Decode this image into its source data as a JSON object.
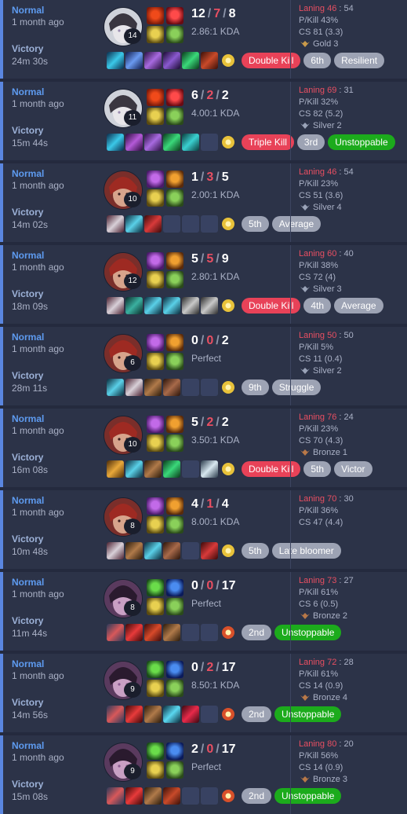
{
  "colors": {
    "accent": "#5e9bf0",
    "death": "#e84f62",
    "badge_red": "#e84258",
    "badge_grey": "#9da3b4",
    "badge_green": "#1cab1c"
  },
  "matches": [
    {
      "mode": "Normal",
      "ago": "1 month ago",
      "result": "Victory",
      "duration": "24m 30s",
      "champion": "pale-mage",
      "level": "14",
      "spells": [
        "ignite-icon",
        "flash-icon",
        "rune-precision-icon",
        "rune-resolve-icon"
      ],
      "kills": "12",
      "deaths": "7",
      "assists": "8",
      "ratio": "2.86:1 KDA",
      "items": [
        "cyan-ring-item",
        "blue-staff-item",
        "violet-orb-item",
        "violet-tome-item",
        "green-vial-item",
        "red-book-item"
      ],
      "badges": [
        {
          "label": "Double Kill",
          "style": "red"
        },
        {
          "label": "6th",
          "style": "grey"
        },
        {
          "label": "Resilient",
          "style": "grey"
        }
      ],
      "laning_label": "Laning 46",
      "laning_vs": "54",
      "pkill": "P/Kill 43%",
      "cs": "CS 81 (3.3)",
      "rank": "Gold 3",
      "rank_color": "#c99a4a"
    },
    {
      "mode": "Normal",
      "ago": "1 month ago",
      "result": "Victory",
      "duration": "15m 44s",
      "champion": "pale-mage",
      "level": "11",
      "spells": [
        "ignite-icon",
        "flash-icon",
        "rune-precision-icon",
        "rune-resolve-icon"
      ],
      "kills": "6",
      "deaths": "2",
      "assists": "2",
      "ratio": "4.00:1 KDA",
      "items": [
        "cyan-ring-item",
        "violet-staff-item",
        "violet-orb-item",
        "green-vial-item",
        "teal-gem-item",
        "empty"
      ],
      "badges": [
        {
          "label": "Triple Kill",
          "style": "red"
        },
        {
          "label": "3rd",
          "style": "grey"
        },
        {
          "label": "Unstoppable",
          "style": "green"
        }
      ],
      "laning_label": "Laning 69",
      "laning_vs": "31",
      "pkill": "P/Kill 32%",
      "cs": "CS 82 (5.2)",
      "rank": "Silver 2",
      "rank_color": "#9aa3b8"
    },
    {
      "mode": "Normal",
      "ago": "1 month ago",
      "result": "Victory",
      "duration": "14m 02s",
      "champion": "red-swordsman",
      "level": "10",
      "spells": [
        "flash-violet-icon",
        "ghost-icon",
        "rune-precision-icon",
        "rune-resolve-icon"
      ],
      "kills": "1",
      "deaths": "3",
      "assists": "5",
      "ratio": "2.00:1 KDA",
      "items": [
        "dagger-item",
        "cyan-blade-item",
        "red-potion-item",
        "empty",
        "empty",
        "empty"
      ],
      "badges": [
        {
          "label": "5th",
          "style": "grey"
        },
        {
          "label": "Average",
          "style": "grey"
        }
      ],
      "laning_label": "Laning 46",
      "laning_vs": "54",
      "pkill": "P/Kill 23%",
      "cs": "CS 51 (3.6)",
      "rank": "Silver 4",
      "rank_color": "#9aa3b8"
    },
    {
      "mode": "Normal",
      "ago": "1 month ago",
      "result": "Victory",
      "duration": "18m 09s",
      "champion": "red-swordsman",
      "level": "12",
      "spells": [
        "flash-violet-icon",
        "ghost-icon",
        "rune-precision-icon",
        "rune-resolve-icon"
      ],
      "kills": "5",
      "deaths": "5",
      "assists": "9",
      "ratio": "2.80:1 KDA",
      "items": [
        "dagger-item",
        "teal-armor-item",
        "cyan-blade-item",
        "cyan-blade-item",
        "grey-sword-item",
        "grey-sword-item"
      ],
      "badges": [
        {
          "label": "Double Kill",
          "style": "red"
        },
        {
          "label": "4th",
          "style": "grey"
        },
        {
          "label": "Average",
          "style": "grey"
        }
      ],
      "laning_label": "Laning 60",
      "laning_vs": "40",
      "pkill": "P/Kill 38%",
      "cs": "CS 72 (4)",
      "rank": "Silver 3",
      "rank_color": "#9aa3b8"
    },
    {
      "mode": "Normal",
      "ago": "1 month ago",
      "result": "Victory",
      "duration": "28m 11s",
      "champion": "red-swordsman",
      "level": "6",
      "spells": [
        "flash-violet-icon",
        "ghost-icon",
        "rune-precision-icon",
        "rune-resolve-icon"
      ],
      "kills": "0",
      "deaths": "0",
      "assists": "2",
      "ratio": "Perfect",
      "items": [
        "cyan-blade-item",
        "dagger-item",
        "brown-boots-item",
        "leather-item",
        "empty",
        "empty"
      ],
      "badges": [
        {
          "label": "9th",
          "style": "grey"
        },
        {
          "label": "Struggle",
          "style": "grey"
        }
      ],
      "laning_label": "Laning 50",
      "laning_vs": "50",
      "pkill": "P/Kill 5%",
      "cs": "CS 11 (0.4)",
      "rank": "Silver 2",
      "rank_color": "#9aa3b8"
    },
    {
      "mode": "Normal",
      "ago": "1 month ago",
      "result": "Victory",
      "duration": "16m 08s",
      "champion": "red-swordsman",
      "level": "10",
      "spells": [
        "flash-violet-icon",
        "ghost-icon",
        "rune-precision-icon",
        "rune-resolve-icon"
      ],
      "kills": "5",
      "deaths": "2",
      "assists": "2",
      "ratio": "3.50:1 KDA",
      "items": [
        "gold-armor-item",
        "cyan-blade-item",
        "brown-boots-item",
        "green-vial-item",
        "empty",
        "silver-blade-item"
      ],
      "badges": [
        {
          "label": "Double Kill",
          "style": "red"
        },
        {
          "label": "5th",
          "style": "grey"
        },
        {
          "label": "Victor",
          "style": "grey"
        }
      ],
      "laning_label": "Laning 76",
      "laning_vs": "24",
      "pkill": "P/Kill 23%",
      "cs": "CS 70 (4.3)",
      "rank": "Bronze 1",
      "rank_color": "#b87848"
    },
    {
      "mode": "Normal",
      "ago": "1 month ago",
      "result": "Victory",
      "duration": "10m 48s",
      "champion": "red-swordsman",
      "level": "8",
      "spells": [
        "flash-violet-icon",
        "ghost-icon",
        "rune-precision-icon",
        "rune-resolve-icon"
      ],
      "kills": "4",
      "deaths": "1",
      "assists": "4",
      "ratio": "8.00:1 KDA",
      "items": [
        "dagger-item",
        "brown-boots-item",
        "cyan-blade-item",
        "leather-item",
        "empty",
        "red-potion-item"
      ],
      "badges": [
        {
          "label": "5th",
          "style": "grey"
        },
        {
          "label": "Late bloomer",
          "style": "grey"
        }
      ],
      "laning_label": "Laning 70",
      "laning_vs": "30",
      "pkill": "P/Kill 36%",
      "cs": "CS 47 (4.4)",
      "rank": "",
      "rank_color": "#9aa3b8"
    },
    {
      "mode": "Normal",
      "ago": "1 month ago",
      "result": "Victory",
      "duration": "11m 44s",
      "champion": "purple-yordle",
      "level": "8",
      "spells": [
        "green-orb-icon",
        "blue-orb-icon",
        "rune-precision-icon",
        "rune-resolve-icon"
      ],
      "kills": "0",
      "deaths": "0",
      "assists": "17",
      "ratio": "Perfect",
      "items": [
        "twin-blade-item",
        "red-demon-item",
        "red-scythe-item",
        "brown-boots-item",
        "empty",
        "empty"
      ],
      "badges": [
        {
          "label": "2nd",
          "style": "grey"
        },
        {
          "label": "Unstoppable",
          "style": "green"
        }
      ],
      "laning_label": "Laning 73",
      "laning_vs": "27",
      "pkill": "P/Kill 61%",
      "cs": "CS 6 (0.5)",
      "rank": "Bronze 2",
      "rank_color": "#b87848"
    },
    {
      "mode": "Normal",
      "ago": "1 month ago",
      "result": "Victory",
      "duration": "14m 56s",
      "champion": "purple-yordle",
      "level": "9",
      "spells": [
        "green-orb-icon",
        "blue-orb-icon",
        "rune-precision-icon",
        "rune-resolve-icon"
      ],
      "kills": "0",
      "deaths": "2",
      "assists": "17",
      "ratio": "8.50:1 KDA",
      "items": [
        "twin-blade-item",
        "red-demon-item",
        "brown-boots-item",
        "cyan-crown-item",
        "red-crystal-item",
        "empty"
      ],
      "badges": [
        {
          "label": "2nd",
          "style": "grey"
        },
        {
          "label": "Unstoppable",
          "style": "green"
        }
      ],
      "laning_label": "Laning 72",
      "laning_vs": "28",
      "pkill": "P/Kill 61%",
      "cs": "CS 14 (0.9)",
      "rank": "Bronze 4",
      "rank_color": "#b87848"
    },
    {
      "mode": "Normal",
      "ago": "1 month ago",
      "result": "Victory",
      "duration": "15m 08s",
      "champion": "purple-yordle",
      "level": "9",
      "spells": [
        "green-orb-icon",
        "blue-orb-icon",
        "rune-precision-icon",
        "rune-resolve-icon"
      ],
      "kills": "2",
      "deaths": "0",
      "assists": "17",
      "ratio": "Perfect",
      "items": [
        "twin-blade-item",
        "red-demon-item",
        "brown-boots-item",
        "red-book-item",
        "empty",
        "empty"
      ],
      "badges": [
        {
          "label": "2nd",
          "style": "grey"
        },
        {
          "label": "Unstoppable",
          "style": "green"
        }
      ],
      "laning_label": "Laning 80",
      "laning_vs": "20",
      "pkill": "P/Kill 56%",
      "cs": "CS 14 (0.9)",
      "rank": "Bronze 3",
      "rank_color": "#b87848"
    }
  ]
}
